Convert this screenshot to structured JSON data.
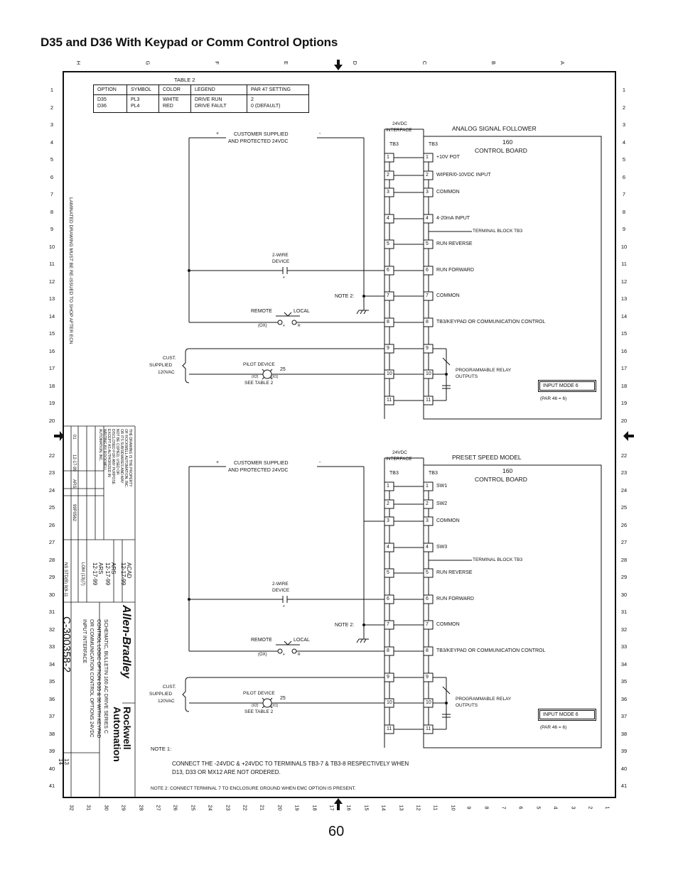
{
  "page": {
    "title": "D35 and D36 With Keypad or Comm Control Options",
    "page_number": "60"
  },
  "grid": {
    "column_letters": [
      "H",
      "G",
      "F",
      "E",
      "D",
      "C",
      "B",
      "A"
    ],
    "row_numbers": [
      "1",
      "2",
      "3",
      "4",
      "5",
      "6",
      "7",
      "8",
      "9",
      "10",
      "11",
      "12",
      "13",
      "14",
      "15",
      "16",
      "17",
      "18",
      "19",
      "20",
      "22",
      "23",
      "24",
      "25",
      "26",
      "27",
      "28",
      "29",
      "30",
      "31",
      "32",
      "33",
      "34",
      "35",
      "36",
      "37",
      "38",
      "39",
      "40",
      "41"
    ],
    "bottom_numbers": [
      "32",
      "31",
      "30",
      "29",
      "28",
      "27",
      "26",
      "25",
      "24",
      "23",
      "22",
      "21",
      "20",
      "19",
      "18",
      "17",
      "16",
      "15",
      "14",
      "13",
      "12",
      "11",
      "10",
      "9",
      "8",
      "7",
      "6",
      "5",
      "4",
      "3",
      "2",
      "1"
    ]
  },
  "table2": {
    "caption": "TABLE 2",
    "headers": [
      "OPTION",
      "SYMBOL",
      "COLOR",
      "LEGEND",
      "PAR 47 SETTING"
    ],
    "rows": [
      [
        "D35",
        "PL3",
        "WHITE",
        "DRIVE RUN",
        "2"
      ],
      [
        "D36",
        "PL4",
        "RED",
        "DRIVE FAULT",
        "0 (DEFAULT)"
      ]
    ]
  },
  "side_notice": "LAMINATED DRAWING MUST BE RE-ISSUED TO SHOP AFTER ECN",
  "circuits": [
    {
      "heading": "ANALOG SIGNAL FOLLOWER",
      "supply_plus": "+",
      "supply_minus": "-",
      "supply_label_1": "CUSTOMER SUPPLIED",
      "supply_label_2": "AND PROTECTED 24VDC",
      "interface_label_1": "24VDC",
      "interface_label_2": "INTERFACE",
      "tb_left": "TB3",
      "tb_right": "TB3",
      "board_1": "160",
      "board_2": "CONTROL BOARD",
      "terminal_block_label": "TERMINAL BLOCK TB3",
      "terminals": [
        "1",
        "2",
        "3",
        "4",
        "5",
        "6",
        "7",
        "8",
        "9",
        "10",
        "11"
      ],
      "functions": [
        "+10V POT",
        "WIPER/0-10VDC INPUT",
        "COMMON",
        "4-20mA INPUT",
        "RUN REVERSE",
        "RUN FORWARD",
        "COMMON",
        "TB3/KEYPAD OR COMMUNICATION CONTROL"
      ],
      "two_wire_1": "2-WIRE",
      "two_wire_2": "DEVICE",
      "asterisk": "*",
      "note2": "NOTE 2:",
      "remote": "REMOTE",
      "local": "LOCAL",
      "ox": "(OX)",
      "r": "R",
      "cust_1": "CUST.",
      "cust_2": "SUPPLIED",
      "cust_3": "120VAC",
      "pilot": "PILOT DEVICE",
      "pilot_num": "25",
      "x2": "(X2)",
      "x1": "(X1)",
      "see_table": "SEE TABLE 2",
      "relay_1": "PROGRAMMABLE RELAY",
      "relay_2": "OUTPUTS",
      "input_mode": "INPUT MODE 6",
      "par46": "(PAR 46 = 6)"
    },
    {
      "heading": "PRESET SPEED MODEL",
      "supply_plus": "+",
      "supply_minus": "-",
      "supply_label_1": "CUSTOMER SUPPLIED",
      "supply_label_2": "AND PROTECTED 24VDC",
      "interface_label_1": "24VDC",
      "interface_label_2": "INTERFACE",
      "tb_left": "TB3",
      "tb_right": "TB3",
      "board_1": "160",
      "board_2": "CONTROL BOARD",
      "terminal_block_label": "TERMINAL BLOCK TB3",
      "terminals": [
        "1",
        "2",
        "3",
        "4",
        "5",
        "6",
        "7",
        "8",
        "9",
        "10",
        "11"
      ],
      "functions": [
        "SW1",
        "SW2",
        "COMMON",
        "SW3",
        "RUN REVERSE",
        "RUN FORWARD",
        "COMMON",
        "TB3/KEYPAD OR COMMUNICATION CONTROL"
      ],
      "two_wire_1": "2-WIRE",
      "two_wire_2": "DEVICE",
      "asterisk": "*",
      "note2": "NOTE 2:",
      "remote": "REMOTE",
      "local": "LOCAL",
      "ox": "(OX)",
      "r": "R",
      "cust_1": "CUST.",
      "cust_2": "SUPPLIED",
      "cust_3": "120VAC",
      "pilot": "PILOT DEVICE",
      "pilot_num": "25",
      "x2": "(X2)",
      "x1": "(X1)",
      "see_table": "SEE TABLE 2",
      "relay_1": "PROGRAMMABLE RELAY",
      "relay_2": "OUTPUTS",
      "input_mode": "INPUT MODE 6",
      "par46": "(PAR 46 = 6)"
    }
  ],
  "notes": {
    "note1_label": "NOTE 1:",
    "note1_line1": "CONNECT THE -24VDC & +24VDC TO TERMINALS TB3-7 & TB3-8 RESPECTIVELY WHEN",
    "note1_line2": "D13, D33 OR MX12 ARE NOT ORDERED.",
    "note2": "NOTE 2: CONNECT TERMINAL 7 TO ENCLOSURE GROUND WHEN EMC OPTION IS PRESENT."
  },
  "title_block": {
    "property_notice": "THE DRAWING IS THE PROPERTY OF ROCKWELL AUTOMATION, INC. OR ITS SUBSIDIARIES AND MAY NOT BE COPIED, USED OR DISCLOSED FOR ANY PURPOSE EXCEPT AS AUTHORIZED IN WRITING BY ROCKWELL AUTOMATION, INC.",
    "rev": "01",
    "rev_date": "12-17-99",
    "rev_by": "ARS",
    "ecn": "99P0562",
    "dr": "ACAD",
    "dr_date": "12-17-99",
    "chk": "ARS",
    "chk_date": "12-17-99",
    "appd": "ARS",
    "appd_date": "12-17-99",
    "reference": "LOM (13)(7)",
    "model": "NS STD(B) 9(8-11",
    "brand_1": "Allen-Bradley",
    "brand_2": "Rockwell Automation",
    "title_text": "SCHEMATIC, BULLETIN 160 AC DRIVE SERIES C CONTROL LOGIC OPTION D35 & 36 WITH KEYPAD OR COMMUNICATION CONTROL OPTIONS 24VDC INPUT INTERFACE",
    "drawing_no": "C-300358-2",
    "sheet": "13",
    "of": "14"
  }
}
